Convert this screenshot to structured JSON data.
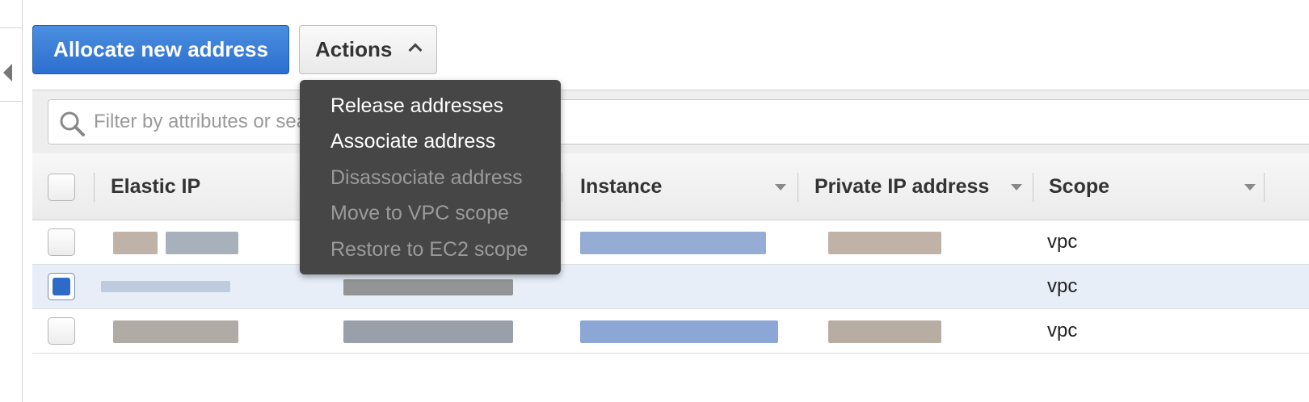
{
  "toolbar": {
    "allocate_label": "Allocate new address",
    "actions_label": "Actions"
  },
  "filter": {
    "placeholder": "Filter by attributes or search by keyword"
  },
  "table": {
    "columns": [
      "Elastic IP",
      "Instance",
      "Private IP address",
      "Scope"
    ],
    "rows": [
      {
        "selected": false,
        "scope": "vpc"
      },
      {
        "selected": true,
        "scope": "vpc"
      },
      {
        "selected": false,
        "scope": "vpc"
      }
    ]
  },
  "actions_menu": {
    "items": [
      {
        "label": "Release addresses",
        "enabled": true
      },
      {
        "label": "Associate address",
        "enabled": true
      },
      {
        "label": "Disassociate address",
        "enabled": false
      },
      {
        "label": "Move to VPC scope",
        "enabled": false
      },
      {
        "label": "Restore to EC2 scope",
        "enabled": false
      }
    ]
  },
  "colors": {
    "primary_button": "#2c6fcf",
    "menu_background": "#464646",
    "selected_row": "#e8eef8",
    "checkbox_checked": "#2d6bc6"
  },
  "icons": {
    "search": "search-icon",
    "collapse": "collapse-left-icon",
    "actions_caret": "chevron-up-icon"
  }
}
